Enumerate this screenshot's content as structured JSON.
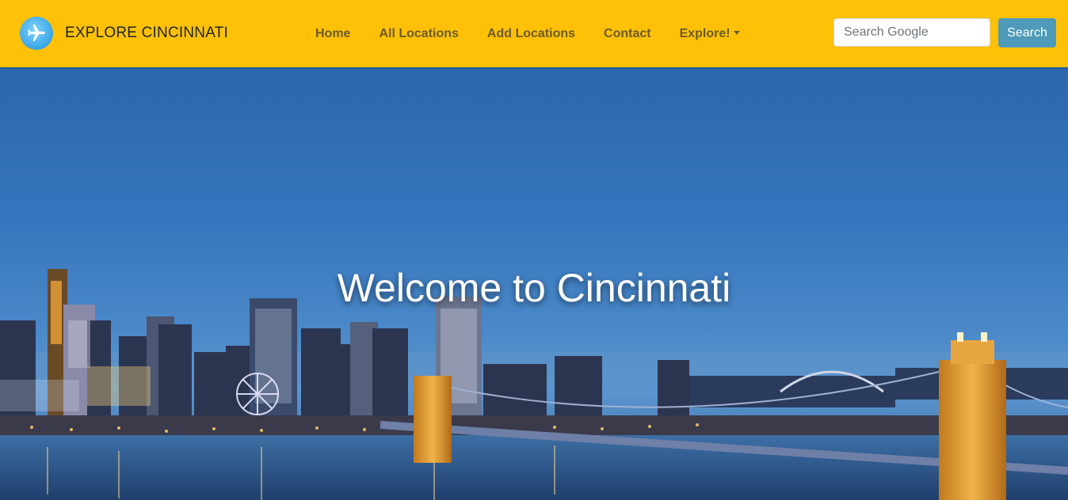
{
  "brand": {
    "title": "EXPLORE CINCINNATI",
    "logo_icon": "airplane-icon"
  },
  "nav": {
    "items": [
      {
        "label": "Home"
      },
      {
        "label": "All Locations"
      },
      {
        "label": "Add Locations"
      },
      {
        "label": "Contact"
      },
      {
        "label": "Explore!"
      }
    ]
  },
  "search": {
    "placeholder": "Search Google",
    "button_label": "Search"
  },
  "hero": {
    "title": "Welcome to Cincinnati"
  },
  "colors": {
    "navbar": "#ffc107",
    "search_button": "#4e9ab8",
    "nav_text": "#6b5a2a"
  }
}
